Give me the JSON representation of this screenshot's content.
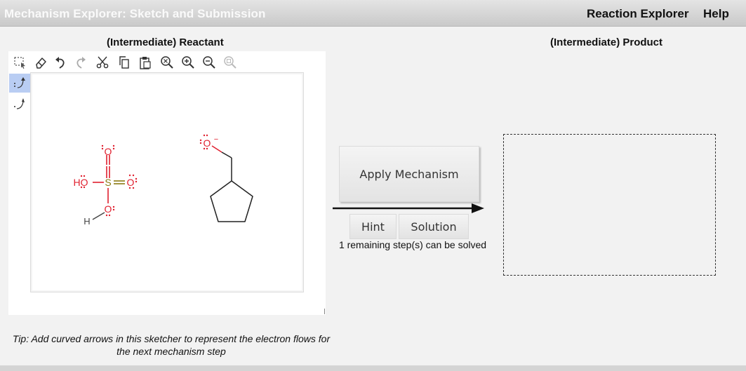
{
  "app": {
    "title": "Mechanism Explorer: Sketch and Submission",
    "nav": [
      "Reaction Explorer",
      "Help"
    ]
  },
  "reactant": {
    "heading": "(Intermediate) Reactant",
    "toolbar_icons": [
      "selection-icon",
      "eraser-icon",
      "undo-icon",
      "redo-icon",
      "cut-icon",
      "copy-icon",
      "paste-icon",
      "zoom-fit-icon",
      "zoom-in-icon",
      "zoom-out-icon",
      "zoom-reset-icon"
    ],
    "side_tools": [
      "electron-pair-arrow-icon",
      "single-electron-arrow-icon"
    ],
    "molecule1": {
      "hetero_o_top": "O",
      "s_atom": "S",
      "o_right": "O",
      "o_bottom": "O",
      "ho_left": "HO",
      "h_bottom": "H"
    },
    "molecule2": {
      "alkoxide_o": "O",
      "charge": "−"
    },
    "tip": "Tip: Add curved arrows in this sketcher to represent the electron flows for the next mechanism step"
  },
  "controls": {
    "apply_label": "Apply Mechanism",
    "hint_label": "Hint",
    "solution_label": "Solution",
    "status": "1 remaining step(s) can be solved"
  },
  "product": {
    "heading": "(Intermediate) Product"
  },
  "colors": {
    "atom_red": "#e0202f",
    "sulfur": "#8a7a10",
    "bond": "#222222",
    "active_tool": "#b9cdf3"
  }
}
